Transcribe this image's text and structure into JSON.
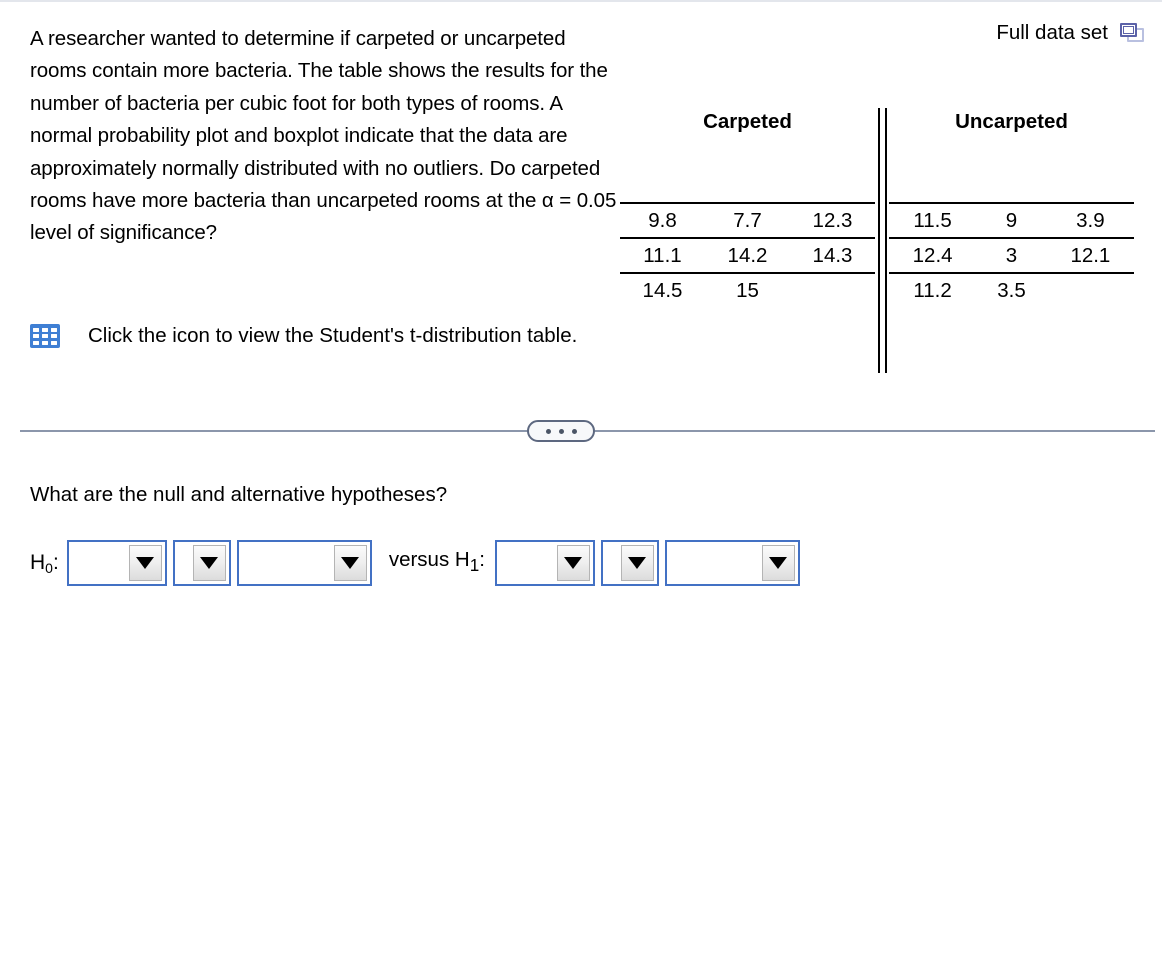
{
  "problem": {
    "stem": "A researcher wanted to determine if carpeted or uncarpeted rooms contain more bacteria. The table shows the results for the number of bacteria per cubic foot for both types of rooms. A normal probability plot and boxplot indicate that the data are approximately normally distributed with no outliers. Do carpeted rooms have more bacteria than uncarpeted rooms at the α = 0.05 level of significance?",
    "tdist_link_text": "Click the icon to view the Student's t-distribution table.",
    "tdist_icon": "grid-table-icon"
  },
  "full_data_set": {
    "label": "Full data set",
    "icon": "popout-window-icon"
  },
  "tables": {
    "carpeted": {
      "header": "Carpeted",
      "rows": [
        [
          "9.8",
          "7.7",
          "12.3"
        ],
        [
          "11.1",
          "14.2",
          "14.3"
        ],
        [
          "14.5",
          "15",
          ""
        ]
      ]
    },
    "uncarpeted": {
      "header": "Uncarpeted",
      "rows": [
        [
          "11.5",
          "9",
          "3.9"
        ],
        [
          "12.4",
          "3",
          "12.1"
        ],
        [
          "11.2",
          "3.5",
          ""
        ]
      ]
    }
  },
  "divider": {
    "more_label": "•••"
  },
  "question": {
    "prompt": "What are the null and alternative hypotheses?",
    "null_label": "H",
    "null_sub": "0",
    "null_colon": ":",
    "versus": "versus H",
    "alt_sub": "1",
    "alt_colon": ":",
    "dropdowns": [
      {
        "id": "h0-subject",
        "value": ""
      },
      {
        "id": "h0-operator",
        "value": ""
      },
      {
        "id": "h0-object",
        "value": ""
      },
      {
        "id": "h1-subject",
        "value": ""
      },
      {
        "id": "h1-operator",
        "value": ""
      },
      {
        "id": "h1-object",
        "value": ""
      }
    ]
  },
  "colors": {
    "dropdown_border": "#4371c4",
    "divider": "#8b96ab",
    "icon_blue": "#3f7fd4",
    "popout_blue": "#5b62a8"
  }
}
